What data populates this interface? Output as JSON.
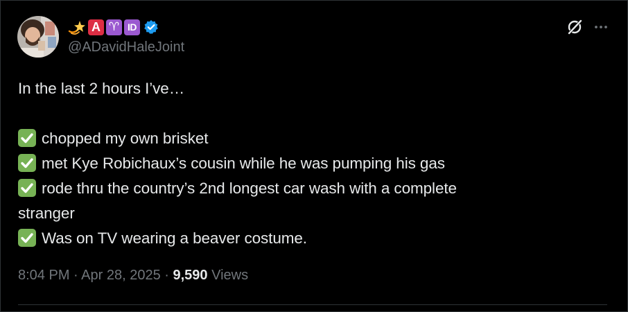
{
  "author": {
    "display_name_emojis": [
      "dizzy",
      "A",
      "aries",
      "ID"
    ],
    "badge_a_text": "A",
    "badge_aries_text": "♈",
    "badge_id_text": "ID",
    "handle": "@ADavidHaleJoint",
    "verified": true
  },
  "tweet": {
    "intro": "In the last 2 hours I’ve…",
    "checklist": [
      "chopped my own brisket",
      "met Kye Robichaux’s cousin while he was pumping his gas",
      "rode thru the country’s 2nd longest car wash with a complete",
      "stranger",
      "Was on TV wearing a beaver costume."
    ]
  },
  "meta": {
    "time": "8:04 PM",
    "separator": "·",
    "date": "Apr 28, 2025",
    "views_count": "9,590",
    "views_label": "Views"
  },
  "icons": {
    "top_right": [
      "grok-icon",
      "more-icon"
    ],
    "verified": "verified-badge-icon",
    "check": "check-mark-button-icon"
  },
  "colors": {
    "background": "#000000",
    "text": "#e7e9ea",
    "secondary_text": "#71767b",
    "verified_blue": "#1d9bf0",
    "check_green": "#77b255",
    "divider": "#2f3336"
  }
}
